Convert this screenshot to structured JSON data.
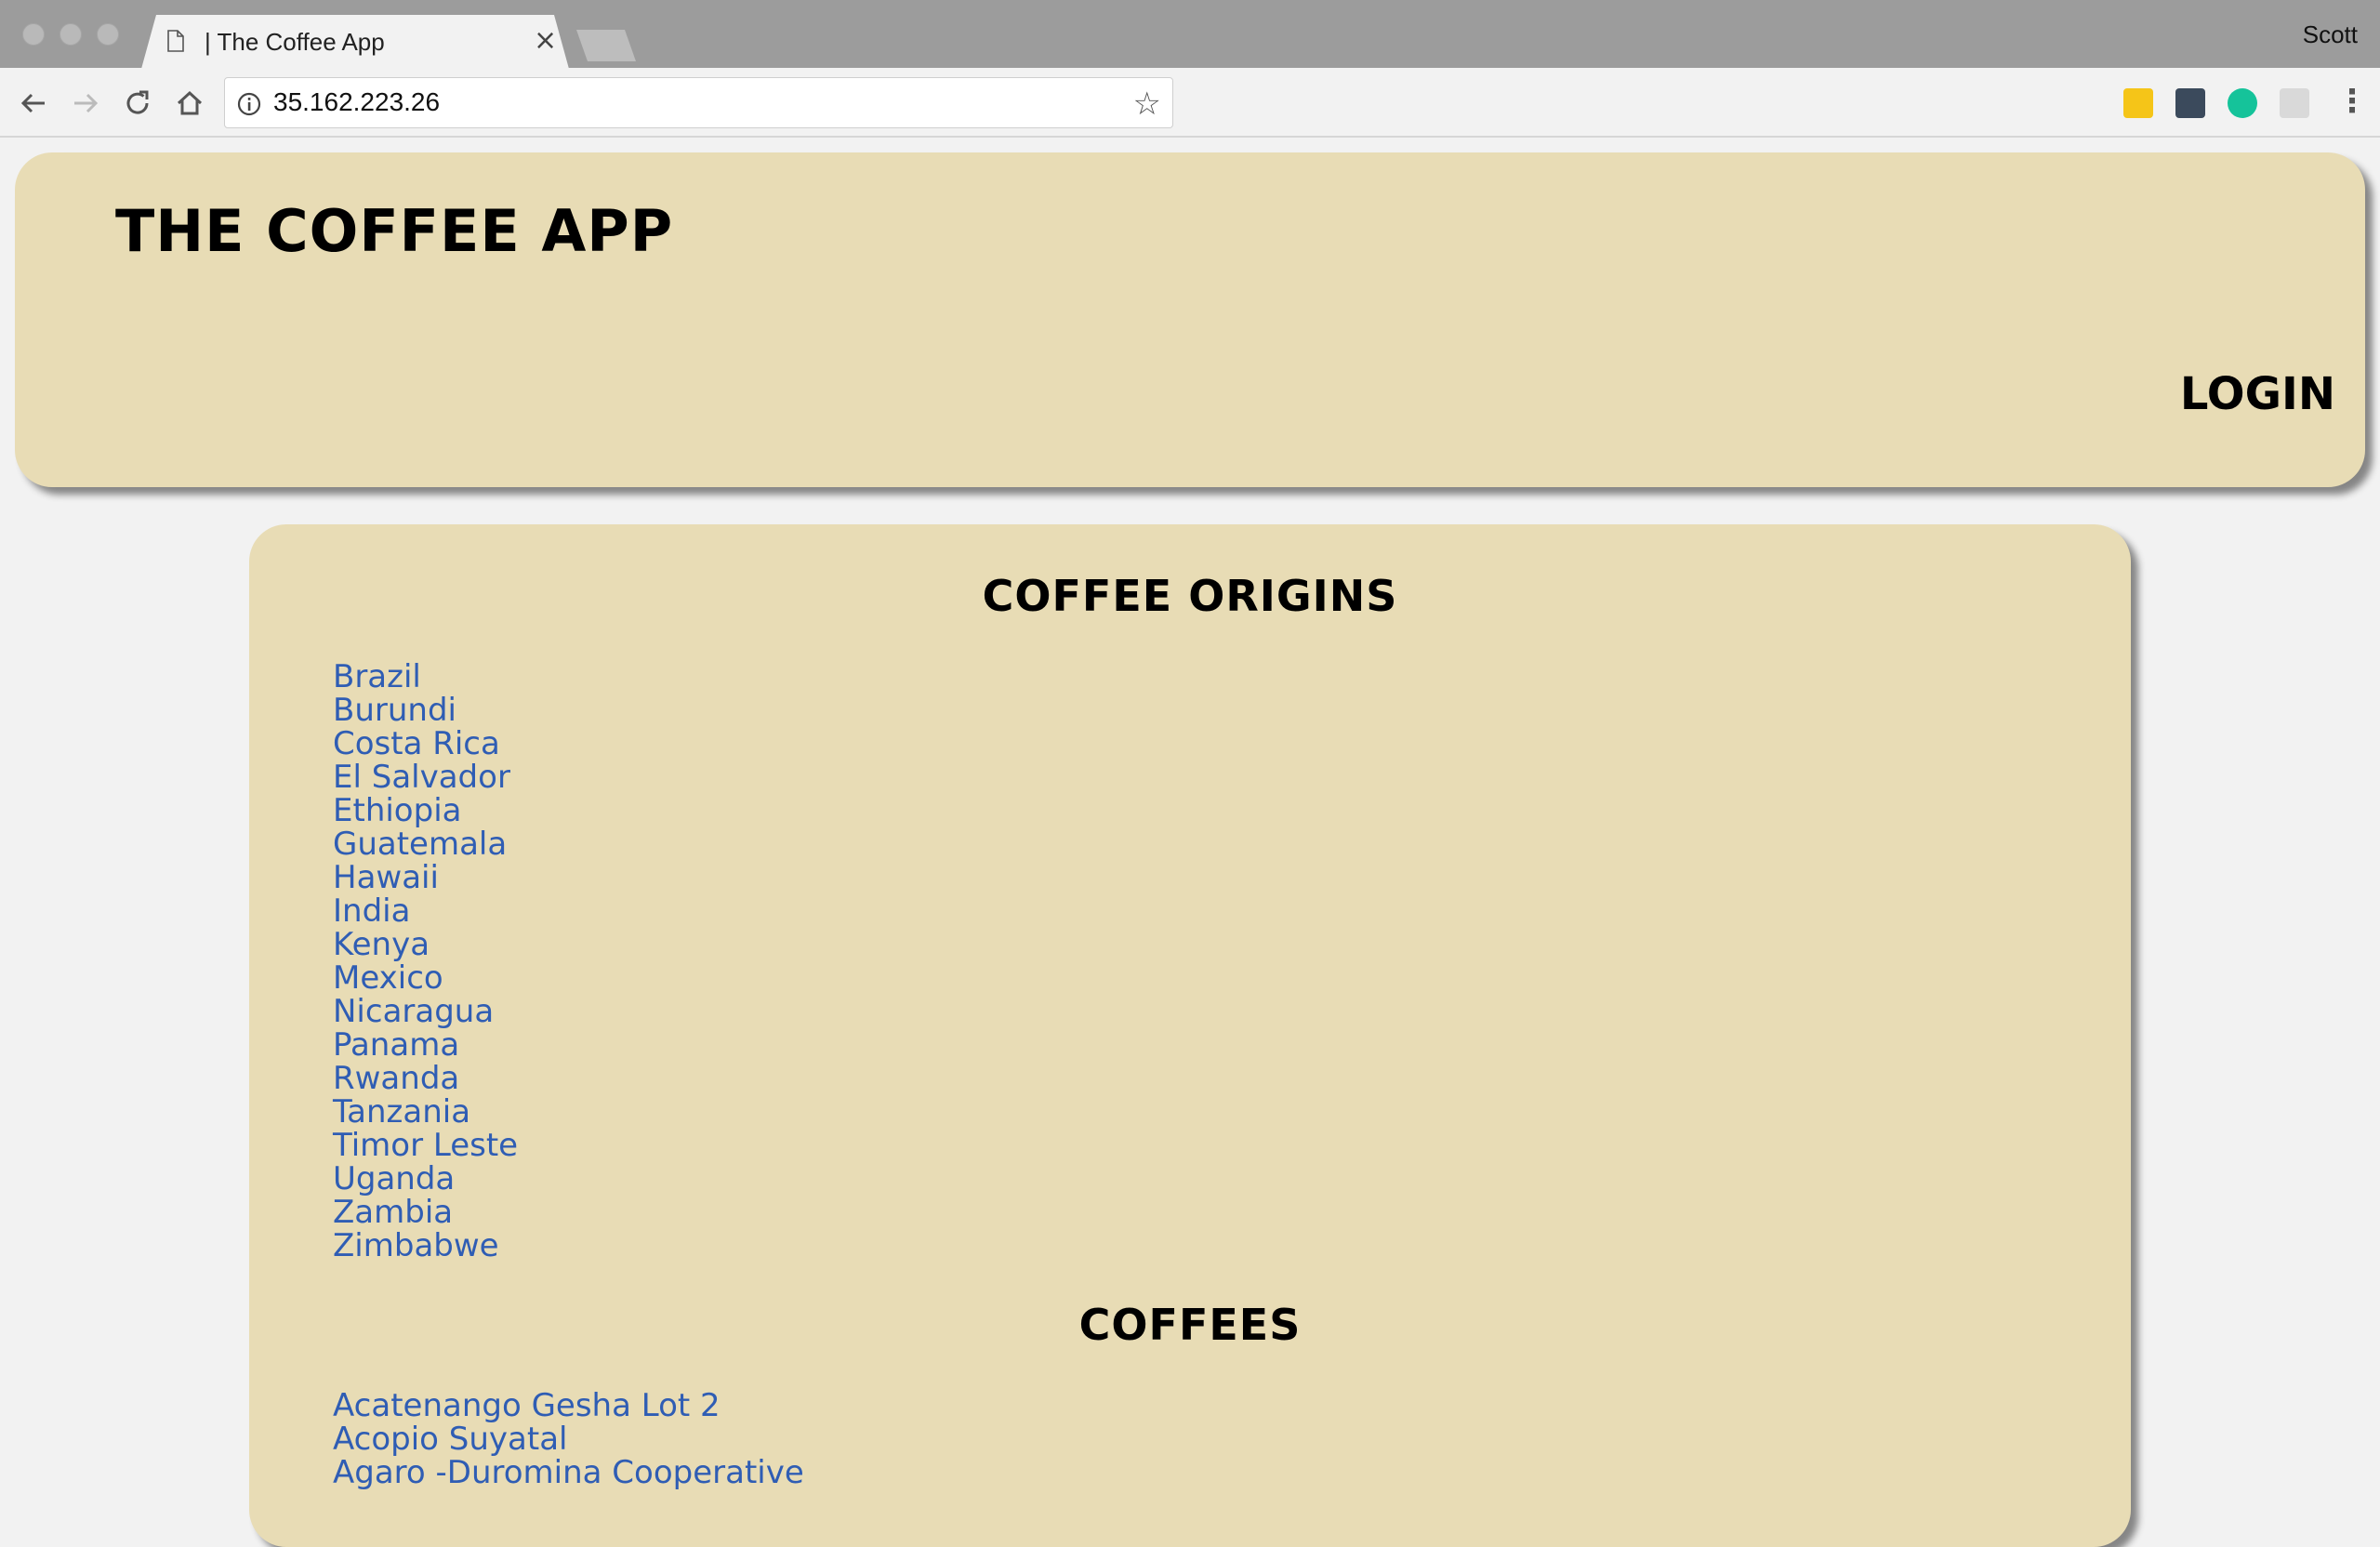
{
  "browser": {
    "tab_title": "| The Coffee App",
    "tab_close": "×",
    "profile_name": "Scott",
    "url": "35.162.223.26",
    "star_glyph": "☆",
    "menu_glyph": "⋮"
  },
  "header": {
    "app_title": "The Coffee App",
    "login_label": "Login"
  },
  "origins": {
    "heading": "Coffee Origins",
    "items": [
      "Brazil",
      "Burundi",
      "Costa Rica",
      "El Salvador",
      "Ethiopia",
      "Guatemala",
      "Hawaii",
      "India",
      "Kenya",
      "Mexico",
      "Nicaragua",
      "Panama",
      "Rwanda",
      "Tanzania",
      "Timor Leste",
      "Uganda",
      "Zambia",
      "Zimbabwe"
    ]
  },
  "coffees": {
    "heading": "Coffees",
    "items": [
      "Acatenango Gesha Lot 2",
      "Acopio Suyatal",
      "Agaro -Duromina Cooperative"
    ]
  },
  "colors": {
    "card_bg": "#e8dcb5",
    "link": "#2f5db4",
    "page_bg": "#f2f2f2"
  }
}
